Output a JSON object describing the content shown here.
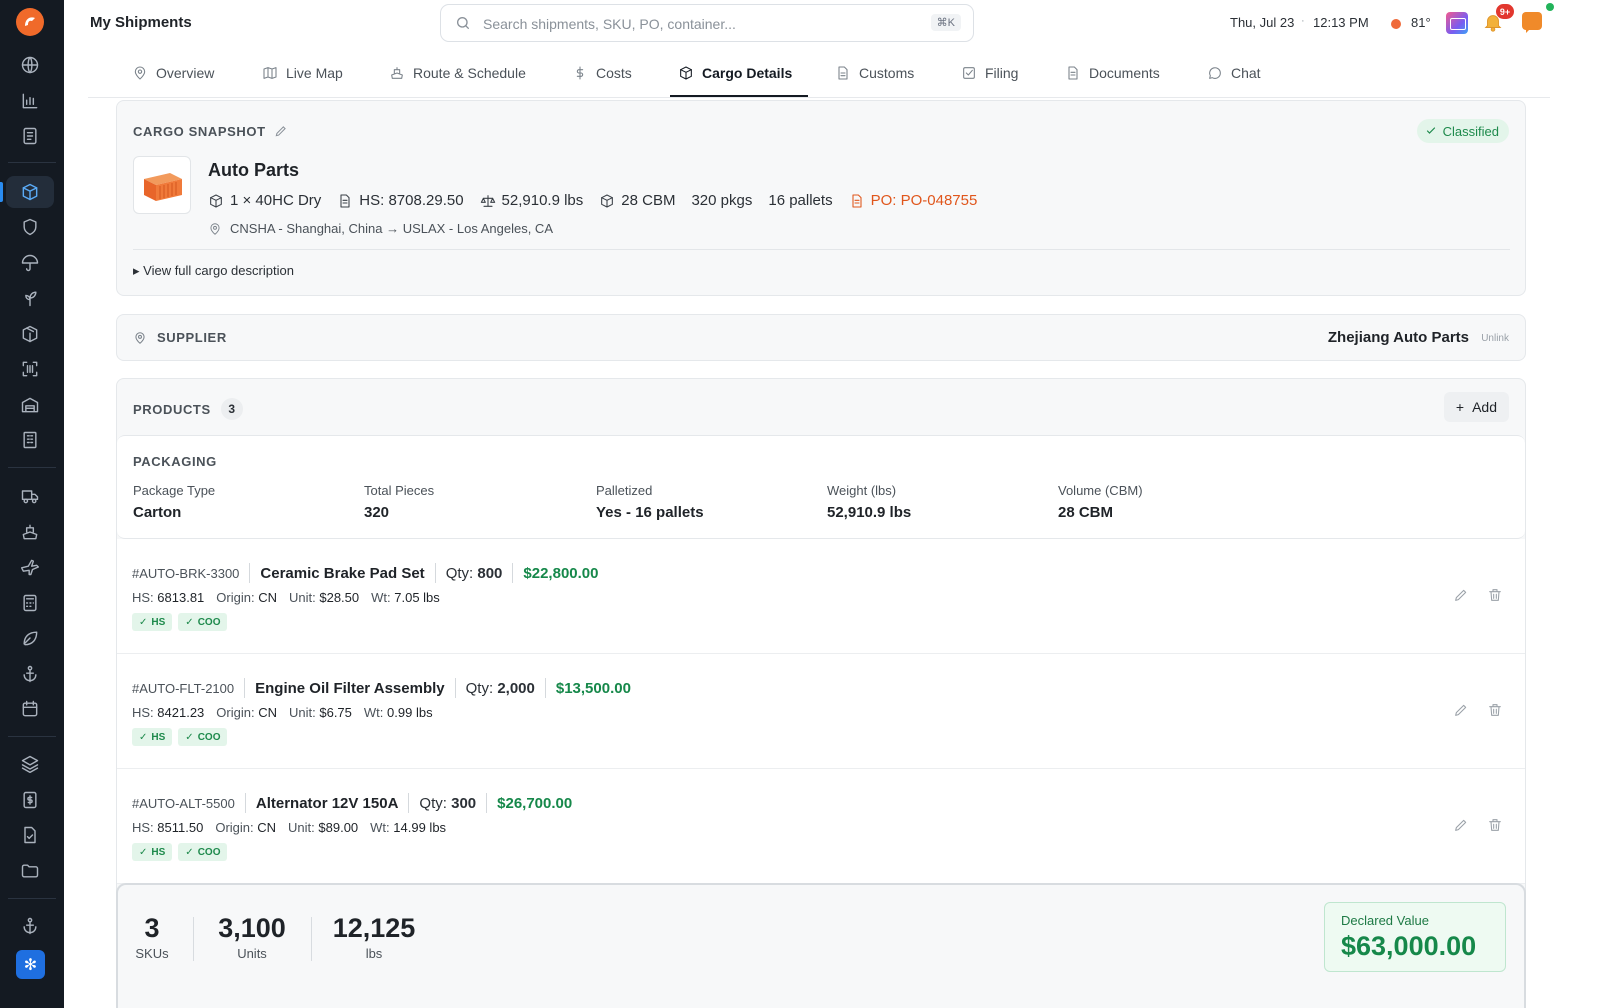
{
  "app": {
    "title": "My Shipments"
  },
  "search": {
    "placeholder": "Search shipments, SKU, PO, container...",
    "shortcut": "⌘K"
  },
  "status": {
    "date": "Thu, Jul 23",
    "time": "12:13 PM",
    "temperature": "81°",
    "notifications": "9+"
  },
  "tabs": [
    {
      "label": "Overview",
      "icon": "map-pin-icon"
    },
    {
      "label": "Live Map",
      "icon": "map-icon"
    },
    {
      "label": "Route & Schedule",
      "icon": "ship-icon"
    },
    {
      "label": "Costs",
      "icon": "dollar-icon"
    },
    {
      "label": "Cargo Details",
      "icon": "package-icon",
      "active": true
    },
    {
      "label": "Customs",
      "icon": "document-icon"
    },
    {
      "label": "Filing",
      "icon": "checkbox-icon"
    },
    {
      "label": "Documents",
      "icon": "file-icon"
    },
    {
      "label": "Chat",
      "icon": "chat-bubble-icon"
    }
  ],
  "snapshot": {
    "label": "CARGO SNAPSHOT",
    "status": "Classified",
    "title": "Auto Parts",
    "container": "1 × 40HC Dry",
    "hs": "HS: 8708.29.50",
    "weight": "52,910.9 lbs",
    "volume": "28 CBM",
    "pkgs": "320 pkgs",
    "pallets": "16 pallets",
    "po": "PO: PO-048755",
    "route": "CNSHA - Shanghai, China → USLAX - Los Angeles, CA",
    "view_full": "▸ View full cargo description"
  },
  "supplier": {
    "label": "SUPPLIER",
    "name": "Zhejiang Auto Parts",
    "unlink": "Unlink"
  },
  "products": {
    "label": "PRODUCTS",
    "count": "3",
    "add_label": "Add",
    "packaging": {
      "label": "PACKAGING",
      "fields": [
        {
          "key": "Package Type",
          "value": "Carton"
        },
        {
          "key": "Total Pieces",
          "value": "320"
        },
        {
          "key": "Palletized",
          "value": "Yes - 16 pallets"
        },
        {
          "key": "Weight (lbs)",
          "value": "52,910.9 lbs"
        },
        {
          "key": "Volume (CBM)",
          "value": "28 CBM"
        }
      ]
    },
    "items": [
      {
        "sku": "#AUTO-BRK-3300",
        "name": "Ceramic Brake Pad Set",
        "qty_label": "Qty:",
        "qty": "800",
        "total": "$22,800.00",
        "hs_label": "HS:",
        "hs": "6813.81",
        "origin_label": "Origin:",
        "origin": "CN",
        "unit_label": "Unit:",
        "unit": "$28.50",
        "wt_label": "Wt:",
        "wt": "7.05 lbs",
        "tags": [
          "HS",
          "COO"
        ]
      },
      {
        "sku": "#AUTO-FLT-2100",
        "name": "Engine Oil Filter Assembly",
        "qty_label": "Qty:",
        "qty": "2,000",
        "total": "$13,500.00",
        "hs_label": "HS:",
        "hs": "8421.23",
        "origin_label": "Origin:",
        "origin": "CN",
        "unit_label": "Unit:",
        "unit": "$6.75",
        "wt_label": "Wt:",
        "wt": "0.99 lbs",
        "tags": [
          "HS",
          "COO"
        ]
      },
      {
        "sku": "#AUTO-ALT-5500",
        "name": "Alternator 12V 150A",
        "qty_label": "Qty:",
        "qty": "300",
        "total": "$26,700.00",
        "hs_label": "HS:",
        "hs": "8511.50",
        "origin_label": "Origin:",
        "origin": "CN",
        "unit_label": "Unit:",
        "unit": "$89.00",
        "wt_label": "Wt:",
        "wt": "14.99 lbs",
        "tags": [
          "HS",
          "COO"
        ]
      }
    ]
  },
  "summary": {
    "skus": {
      "value": "3",
      "label": "SKUs"
    },
    "units": {
      "value": "3,100",
      "label": "Units"
    },
    "weight": {
      "value": "12,125",
      "label": "lbs"
    },
    "declared": {
      "label": "Declared Value",
      "value": "$63,000.00"
    }
  },
  "colors": {
    "accent": "#16884a",
    "brand": "#f06a2a",
    "po": "#e0561c",
    "sidebar": "#141a22"
  }
}
